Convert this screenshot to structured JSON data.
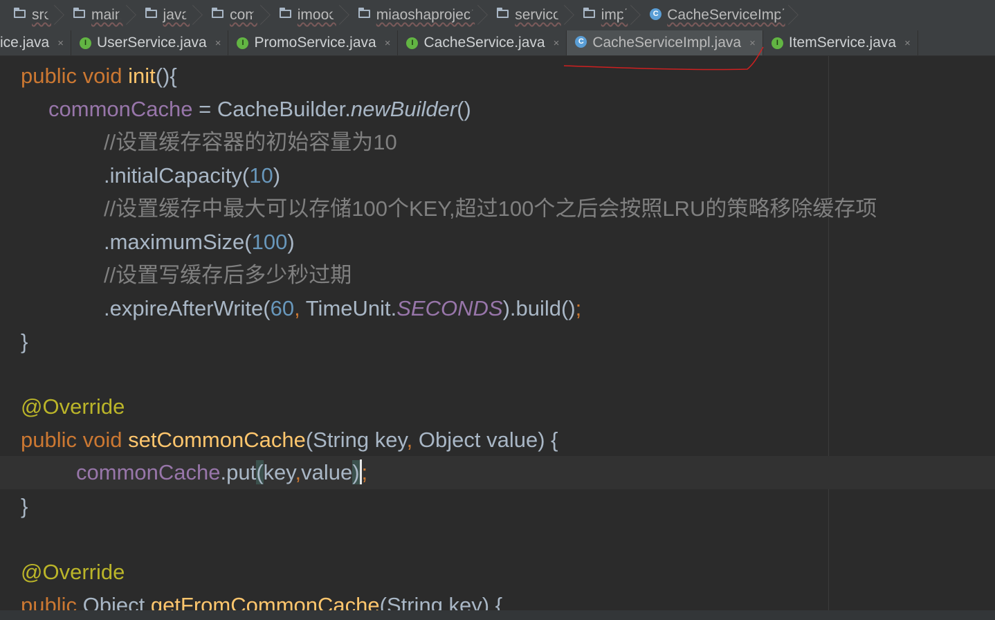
{
  "breadcrumb": {
    "items": [
      {
        "label": "src",
        "icon": "folder-icon"
      },
      {
        "label": "main",
        "icon": "folder-icon"
      },
      {
        "label": "java",
        "icon": "folder-icon"
      },
      {
        "label": "com",
        "icon": "folder-icon"
      },
      {
        "label": "imooc",
        "icon": "folder-icon"
      },
      {
        "label": "miaoshaproject",
        "icon": "folder-icon"
      },
      {
        "label": "service",
        "icon": "folder-icon"
      },
      {
        "label": "impl",
        "icon": "folder-icon"
      },
      {
        "label": "CacheServiceImpl",
        "icon": "class-icon"
      }
    ]
  },
  "tabs": [
    {
      "label": "ice.java",
      "close": "×",
      "icon": "none"
    },
    {
      "label": "UserService.java",
      "close": "×",
      "icon": "interface-icon"
    },
    {
      "label": "PromoService.java",
      "close": "×",
      "icon": "interface-icon"
    },
    {
      "label": "CacheService.java",
      "close": "×",
      "icon": "interface-icon"
    },
    {
      "label": "CacheServiceImpl.java",
      "close": "×",
      "icon": "class-icon",
      "active": true
    },
    {
      "label": "ItemService.java",
      "close": "×",
      "icon": "interface-icon"
    }
  ],
  "icons": {
    "class_letter": "C",
    "interface_letter": "I"
  },
  "code": {
    "l1": {
      "kw": "public void ",
      "fn": "init",
      "rest": "(){"
    },
    "l2": {
      "field": "commonCache",
      "eq": " = CacheBuilder.",
      "method": "newBuilder",
      "rest": "()"
    },
    "l3": {
      "comment": "//设置缓存容器的初始容量为10"
    },
    "l4": {
      "call": ".initialCapacity(",
      "num": "10",
      "close": ")"
    },
    "l5": {
      "comment": "//设置缓存中最大可以存储100个KEY,超过100个之后会按照LRU的策略移除缓存项"
    },
    "l6": {
      "call": ".maximumSize(",
      "num": "100",
      "close": ")"
    },
    "l7": {
      "comment": "//设置写缓存后多少秒过期"
    },
    "l8": {
      "call": ".expireAfterWrite(",
      "num": "60",
      "comma": ", ",
      "cls": "TimeUnit.",
      "const": "SECONDS",
      "rest": ").build()",
      "semi": ";"
    },
    "l9": {
      "brace": "}"
    },
    "l10": {
      "annotation": "@Override"
    },
    "l11": {
      "kw": "public void ",
      "fn": "setCommonCache",
      "params": "(String key",
      "comma": ", ",
      "params2": "Object value) {"
    },
    "l12": {
      "field": "commonCache",
      "call": ".put",
      "open": "(",
      "arg1": "key",
      "comma": ",",
      "arg2": "value",
      "close": ")",
      "semi": ";"
    },
    "l13": {
      "brace": "}"
    },
    "l14": {
      "annotation": "@Override"
    },
    "l15": {
      "kw": "public ",
      "type": "Object ",
      "fn": "getFromCommonCache",
      "rest": "(String key) {"
    }
  },
  "colors": {
    "background": "#2b2b2b",
    "keyword": "#cc7832",
    "function": "#ffc66d",
    "field": "#9876aa",
    "number": "#6897bb",
    "comment": "#808080",
    "annotation": "#bbb529",
    "annotation_ink": "#d02020"
  }
}
